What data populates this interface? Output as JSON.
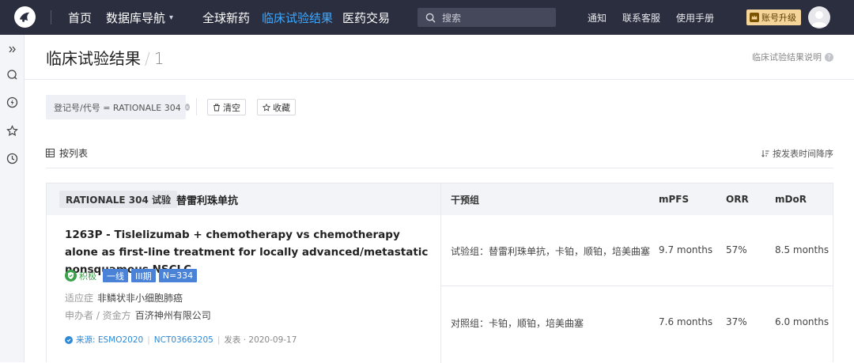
{
  "topbar": {
    "nav": [
      {
        "label": "首页"
      },
      {
        "label": "数据库导航"
      },
      {
        "label": "全球新药"
      },
      {
        "label": "临床试验结果"
      },
      {
        "label": "医药交易"
      }
    ],
    "search_placeholder": "搜索",
    "links": [
      "通知",
      "联系客服",
      "使用手册"
    ],
    "upgrade_label": "账号升级",
    "active_color": "#3ea8ff"
  },
  "page": {
    "title": "临床试验结果",
    "count": "1",
    "help": "临床试验结果说明"
  },
  "filter": {
    "chip": "登记号/代号 = RATIONALE 304",
    "clear": "清空",
    "favorite": "收藏"
  },
  "view": {
    "mode": "按列表",
    "sort": "按发表时间降序"
  },
  "table": {
    "trial": "RATIONALE 304 试验",
    "drug": "替雷利珠单抗",
    "headers": [
      "干预组",
      "mPFS",
      "ORR",
      "mDoR"
    ],
    "publication": {
      "title": "1263P - Tislelizumab + chemotherapy vs chemotherapy alone as first-line treatment for locally advanced/metastatic nonsquamous NSCLC",
      "rating": "积极",
      "tags": [
        "一线",
        "III期",
        "N=334"
      ],
      "indication_label": "适应症",
      "indication": "非鳞状非小细胞肺癌",
      "sponsor_label": "申办者 / 资金方",
      "sponsor": "百济神州有限公司",
      "source": "来源: ESMO2020",
      "nct": "NCT03663205",
      "published": "发表 · 2020-09-17"
    },
    "rows": [
      {
        "group": "试验组：替雷利珠单抗，卡铂，顺铂，培美曲塞",
        "mpfs": "9.7 months",
        "orr": "57%",
        "mdor": "8.5 months"
      },
      {
        "group": "对照组：卡铂，顺铂，培美曲塞",
        "mpfs": "7.6 months",
        "orr": "37%",
        "mdor": "6.0 months"
      }
    ]
  }
}
